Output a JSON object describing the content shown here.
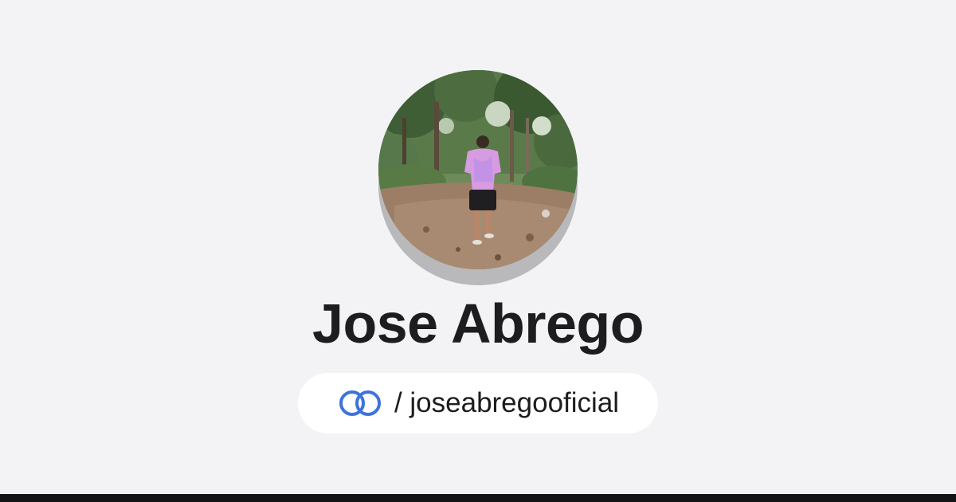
{
  "profile": {
    "display_name": "Jose Abrego",
    "handle_prefix": "/ ",
    "handle": "joseabregooficial",
    "avatar_alt": "profile photo"
  },
  "icons": {
    "link": "link-rings-icon"
  },
  "colors": {
    "background": "#f3f3f6",
    "accent": "#3d73dd",
    "text": "#1d1d1f",
    "pill": "#ffffff",
    "footer": "#141417"
  }
}
